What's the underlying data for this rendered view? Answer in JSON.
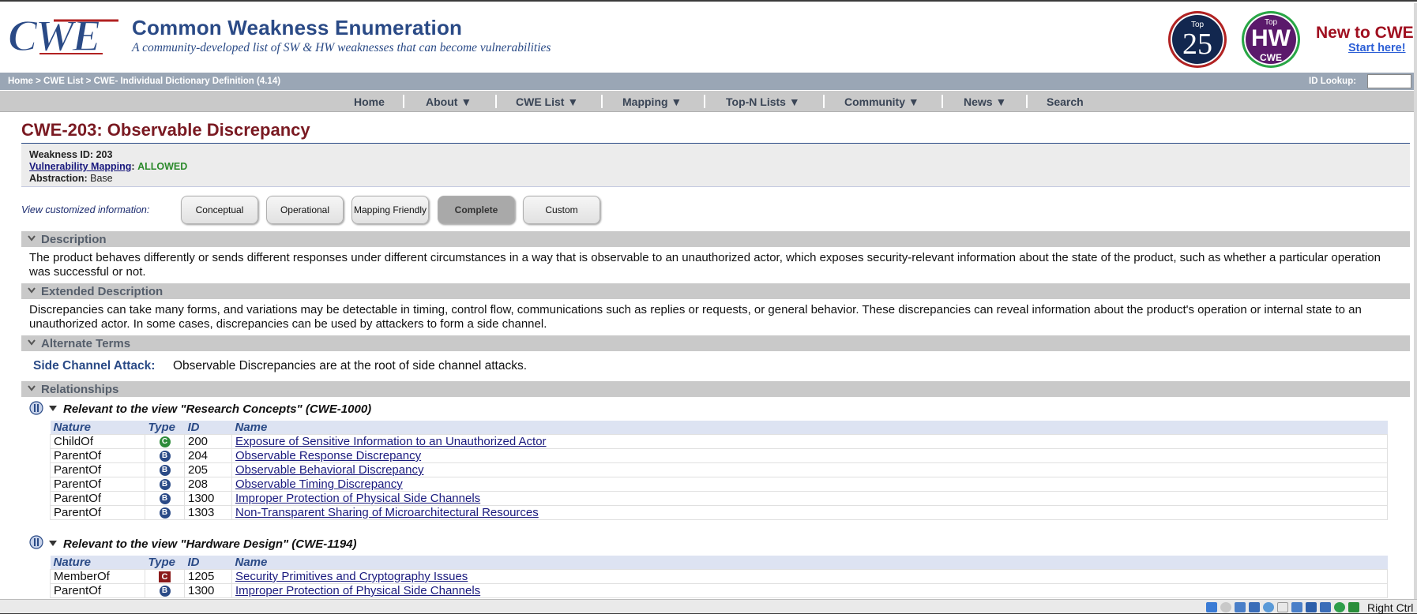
{
  "header": {
    "logo_text": "CWE",
    "site_title": "Common Weakness Enumeration",
    "tagline": "A community-developed list of SW & HW weaknesses that can become vulnerabilities",
    "badge_top25": {
      "small": "Top",
      "big": "25"
    },
    "badge_hw": {
      "small": "Top",
      "big": "HW",
      "sub": "CWE"
    },
    "new_to_cwe": "New to CWE?",
    "start_here": "Start here!"
  },
  "breadcrumb": "Home > CWE List > CWE- Individual Dictionary Definition (4.14)",
  "id_lookup": {
    "label": "ID Lookup:",
    "value": ""
  },
  "nav": {
    "items": [
      "Home",
      "About ▼",
      "CWE List ▼",
      "Mapping ▼",
      "Top-N Lists ▼",
      "Community ▼",
      "News ▼",
      "Search"
    ]
  },
  "page": {
    "title": "CWE-203: Observable Discrepancy",
    "meta": {
      "weakness_id_label": "Weakness ID:",
      "weakness_id": "203",
      "vuln_mapping_label": "Vulnerability Mapping",
      "vuln_mapping_value": "ALLOWED",
      "abstraction_label": "Abstraction:",
      "abstraction_value": "Base"
    },
    "view_custom_label": "View customized information:",
    "view_buttons": [
      "Conceptual",
      "Operational",
      "Mapping Friendly",
      "Complete",
      "Custom"
    ],
    "active_view": "Complete"
  },
  "sections": {
    "description": {
      "title": "Description",
      "text": "The product behaves differently or sends different responses under different circumstances in a way that is observable to an unauthorized actor, which exposes security-relevant information about the state of the product, such as whether a particular operation was successful or not."
    },
    "extended": {
      "title": "Extended Description",
      "text": "Discrepancies can take many forms, and variations may be detectable in timing, control flow, communications such as replies or requests, or general behavior. These discrepancies can reveal information about the product's operation or internal state to an unauthorized actor. In some cases, discrepancies can be used by attackers to form a side channel."
    },
    "alternate_terms": {
      "title": "Alternate Terms",
      "term": "Side Channel Attack:",
      "desc": "Observable Discrepancies are at the root of side channel attacks."
    },
    "relationships": {
      "title": "Relationships",
      "columns": [
        "Nature",
        "Type",
        "ID",
        "Name"
      ],
      "views": [
        {
          "heading": "Relevant to the view \"Research Concepts\" (CWE-1000)",
          "rows": [
            {
              "nature": "ChildOf",
              "type": "C",
              "type_shape": "circle-green",
              "id": "200",
              "name": "Exposure of Sensitive Information to an Unauthorized Actor"
            },
            {
              "nature": "ParentOf",
              "type": "B",
              "type_shape": "circle-blue",
              "id": "204",
              "name": "Observable Response Discrepancy"
            },
            {
              "nature": "ParentOf",
              "type": "B",
              "type_shape": "circle-blue",
              "id": "205",
              "name": "Observable Behavioral Discrepancy"
            },
            {
              "nature": "ParentOf",
              "type": "B",
              "type_shape": "circle-blue",
              "id": "208",
              "name": "Observable Timing Discrepancy"
            },
            {
              "nature": "ParentOf",
              "type": "B",
              "type_shape": "circle-blue",
              "id": "1300",
              "name": "Improper Protection of Physical Side Channels"
            },
            {
              "nature": "ParentOf",
              "type": "B",
              "type_shape": "circle-blue",
              "id": "1303",
              "name": "Non-Transparent Sharing of Microarchitectural Resources"
            }
          ]
        },
        {
          "heading": "Relevant to the view \"Hardware Design\" (CWE-1194)",
          "rows": [
            {
              "nature": "MemberOf",
              "type": "C",
              "type_shape": "square-red",
              "id": "1205",
              "name": "Security Primitives and Cryptography Issues"
            },
            {
              "nature": "ParentOf",
              "type": "B",
              "type_shape": "circle-blue",
              "id": "1300",
              "name": "Improper Protection of Physical Side Channels"
            }
          ]
        }
      ]
    }
  },
  "statusbar": {
    "host_key": "Right Ctrl"
  },
  "colors": {
    "title_red": "#7a1a22",
    "brand_blue": "#2a4a86",
    "allowed_green": "#2b8a2b",
    "section_gray": "#c9c9c9"
  }
}
